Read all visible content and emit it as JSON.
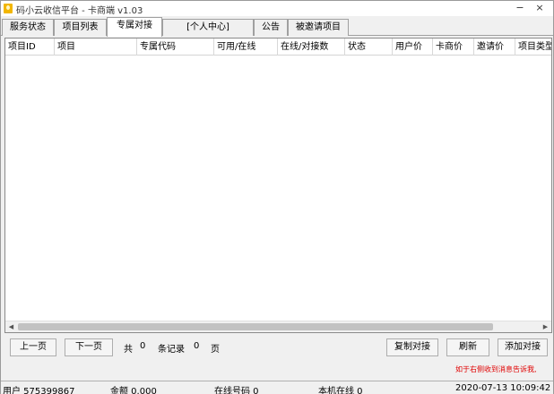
{
  "window": {
    "title": "码小云收信平台 - 卡商端 v1.03",
    "minimize_glyph": "−",
    "close_glyph": "×",
    "icon": "app-logo-icon"
  },
  "tabs": [
    {
      "label": "服务状态",
      "active": false
    },
    {
      "label": "项目列表",
      "active": false
    },
    {
      "label": "专属对接",
      "active": true
    },
    {
      "label": "[个人中心]",
      "active": false
    },
    {
      "label": "公告",
      "active": false
    },
    {
      "label": "被邀请项目",
      "active": false
    }
  ],
  "table": {
    "columns": [
      "项目ID",
      "项目",
      "专属代码",
      "可用/在线",
      "在线/对接数",
      "状态",
      "用户价",
      "卡商价",
      "邀请价",
      "项目类型"
    ],
    "rows": []
  },
  "scroll_arrows": {
    "left": "◀",
    "right": "▶"
  },
  "pager": {
    "prev_label": "上一页",
    "next_label": "下一页",
    "total_prefix": "共",
    "total_count": "0",
    "records_label": "条记录",
    "pages_count": "0",
    "pages_label": "页"
  },
  "actions": {
    "btn1_label": "复制对接",
    "btn2_label": "刷新",
    "btn3_label": "添加对接"
  },
  "ad_notice": "如于右侧收到消息告诉我,",
  "status": {
    "user": "用户 575399867",
    "balance": "金额 0.000",
    "online_numbers": "在线号码 0",
    "local_online": "本机在线 0",
    "datetime": "2020-07-13 10:09:42"
  },
  "colors": {
    "window_bg": "#f0f0f0",
    "table_bg": "#ffffff",
    "notice_red": "#e00000",
    "icon_yellow": "#f2b600"
  }
}
